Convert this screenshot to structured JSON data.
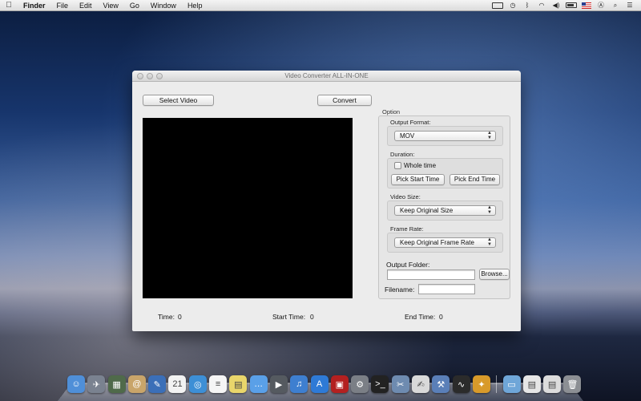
{
  "menubar": {
    "app_name": "Finder",
    "items": [
      "File",
      "Edit",
      "View",
      "Go",
      "Window",
      "Help"
    ],
    "status_icons": [
      "display-icon",
      "time-machine-icon",
      "bluetooth-icon",
      "wifi-icon",
      "volume-icon",
      "battery-icon",
      "us-flag-icon",
      "user-icon",
      "spotlight-search-icon",
      "notification-center-icon"
    ]
  },
  "window": {
    "title": "Video Converter ALL-IN-ONE",
    "select_video_label": "Select Video",
    "convert_label": "Convert",
    "option": {
      "section_label": "Option",
      "output_format_label": "Output Format:",
      "output_format_value": "MOV",
      "duration_label": "Duration:",
      "whole_time_label": "Whole time",
      "whole_time_checked": false,
      "pick_start_label": "Pick Start Time",
      "pick_end_label": "Pick End Time",
      "video_size_label": "Video Size:",
      "video_size_value": "Keep Original Size",
      "frame_rate_label": "Frame Rate:",
      "frame_rate_value": "Keep Original Frame Rate"
    },
    "output_folder_label": "Output Folder:",
    "output_folder_value": "",
    "browse_label": "Browse...",
    "filename_label": "Filename:",
    "filename_value": "",
    "footer": {
      "time_label": "Time:",
      "time_value": "0",
      "start_time_label": "Start Time:",
      "start_time_value": "0",
      "end_time_label": "End Time:",
      "end_time_value": "0"
    }
  },
  "dock": {
    "apps": [
      {
        "name": "finder-icon",
        "color": "#4f8fd8",
        "glyph": "☺"
      },
      {
        "name": "launchpad-icon",
        "color": "#7a8290",
        "glyph": "✈"
      },
      {
        "name": "image-capture-icon",
        "color": "#4f6a4a",
        "glyph": "▦"
      },
      {
        "name": "contacts-icon",
        "color": "#c9a56a",
        "glyph": "@"
      },
      {
        "name": "app-store-pencil-icon",
        "color": "#3b6fb8",
        "glyph": "✎"
      },
      {
        "name": "calendar-icon",
        "color": "#f2f2f2",
        "glyph": "21"
      },
      {
        "name": "safari-icon",
        "color": "#3d8fd6",
        "glyph": "◎"
      },
      {
        "name": "textedit-icon",
        "color": "#f5f5f5",
        "glyph": "≡"
      },
      {
        "name": "stickies-icon",
        "color": "#e9d66b",
        "glyph": "▤"
      },
      {
        "name": "messages-icon",
        "color": "#5aa0e8",
        "glyph": "…"
      },
      {
        "name": "facetime-icon",
        "color": "#555a60",
        "glyph": "▶"
      },
      {
        "name": "itunes-icon",
        "color": "#3e7fd0",
        "glyph": "♫"
      },
      {
        "name": "app-store-icon",
        "color": "#2e7ad6",
        "glyph": "A"
      },
      {
        "name": "photo-booth-icon",
        "color": "#b32020",
        "glyph": "▣"
      },
      {
        "name": "system-preferences-icon",
        "color": "#7b7f86",
        "glyph": "⚙"
      },
      {
        "name": "terminal-icon",
        "color": "#222222",
        "glyph": ">_"
      },
      {
        "name": "preview-icon",
        "color": "#6e8bb0",
        "glyph": "✂"
      },
      {
        "name": "script-editor-icon",
        "color": "#d9d9d9",
        "glyph": "✍"
      },
      {
        "name": "xcode-icon",
        "color": "#5a7fb8",
        "glyph": "⚒"
      },
      {
        "name": "activity-monitor-icon",
        "color": "#2b2b2b",
        "glyph": "∿"
      },
      {
        "name": "video-converter-icon",
        "color": "#d89a2a",
        "glyph": "✦"
      }
    ],
    "extras": [
      {
        "name": "folder-icon",
        "color": "#6fa6d8",
        "glyph": "▭"
      },
      {
        "name": "documents-stack-icon",
        "color": "#e6e6e6",
        "glyph": "▤"
      },
      {
        "name": "downloads-stack-icon",
        "color": "#dcdcdc",
        "glyph": "▤"
      },
      {
        "name": "trash-icon",
        "color": "#8c8f94",
        "glyph": "🗑"
      }
    ]
  }
}
